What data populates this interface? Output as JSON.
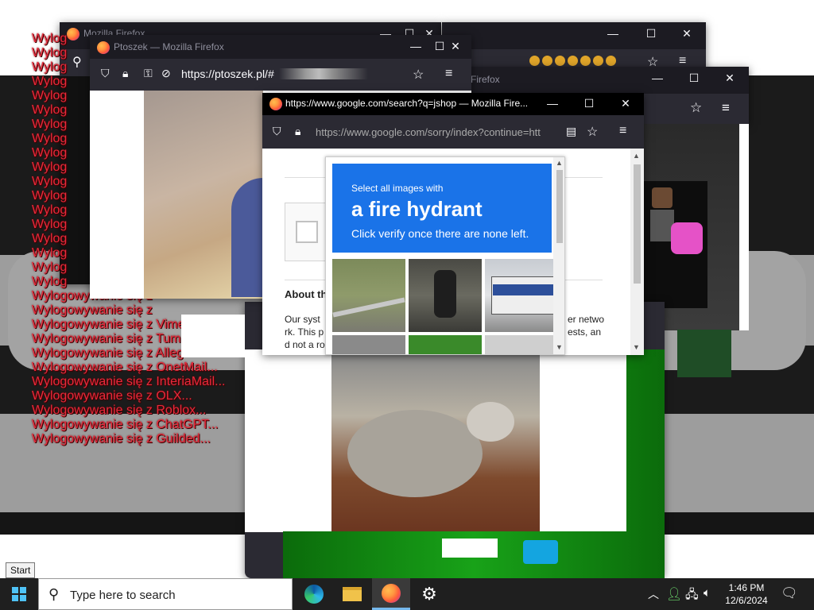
{
  "background_windows": {
    "win_a_title": "Mozilla Firefox",
    "win_c_title": "Firefox"
  },
  "logout_lines": [
    "Wylog",
    "Wylog",
    "Wylog",
    "Wylog",
    "Wylog",
    "Wylog",
    "Wylog",
    "Wylog",
    "Wylog",
    "Wylog",
    "Wylog",
    "Wylog",
    "Wylog",
    "Wylog",
    "Wylog",
    "Wylog",
    "Wylog",
    "Wylog",
    "Wylogowywanie się z",
    "Wylogowywanie się z",
    "Wylogowywanie się z Vime",
    "Wylogowywanie się z Tum",
    "Wylogowywanie się z Alleg",
    "Wylogowywanie się z OnetMail...",
    "Wylogowywanie się z InteriaMail...",
    "Wylogowywanie się z OLX...",
    "Wylogowywanie się z Roblox...",
    "Wylogowywanie się z ChatGPT...",
    "Wylogowywanie się z Guilded..."
  ],
  "ptoszek_window": {
    "title": "Ptoszek — Mozilla Firefox",
    "url": "https://ptoszek.pl/#"
  },
  "google_window": {
    "title": "https://www.google.com/search?q=jshop — Mozilla Fire...",
    "url": "https://www.google.com/sorry/index?continue=htt",
    "about_heading": "About th",
    "about_text_1": "Our syst",
    "about_text_2": "rk. This p",
    "about_text_3": "d not a ro",
    "right_text_1": "er netwo",
    "right_text_2": "ests, an"
  },
  "captcha": {
    "prompt": "Select all images with",
    "target": "a fire hydrant",
    "instruction": "Click verify once there are none left."
  },
  "taskbar": {
    "start_tooltip": "Start",
    "search_placeholder": "Type here to search",
    "time": "1:46 PM",
    "date": "12/6/2024"
  },
  "colors": {
    "firefox_dark": "#1c1b22",
    "firefox_toolbar": "#2b2a33",
    "captcha_blue": "#1a73e8",
    "logout_red": "#e8293b"
  }
}
